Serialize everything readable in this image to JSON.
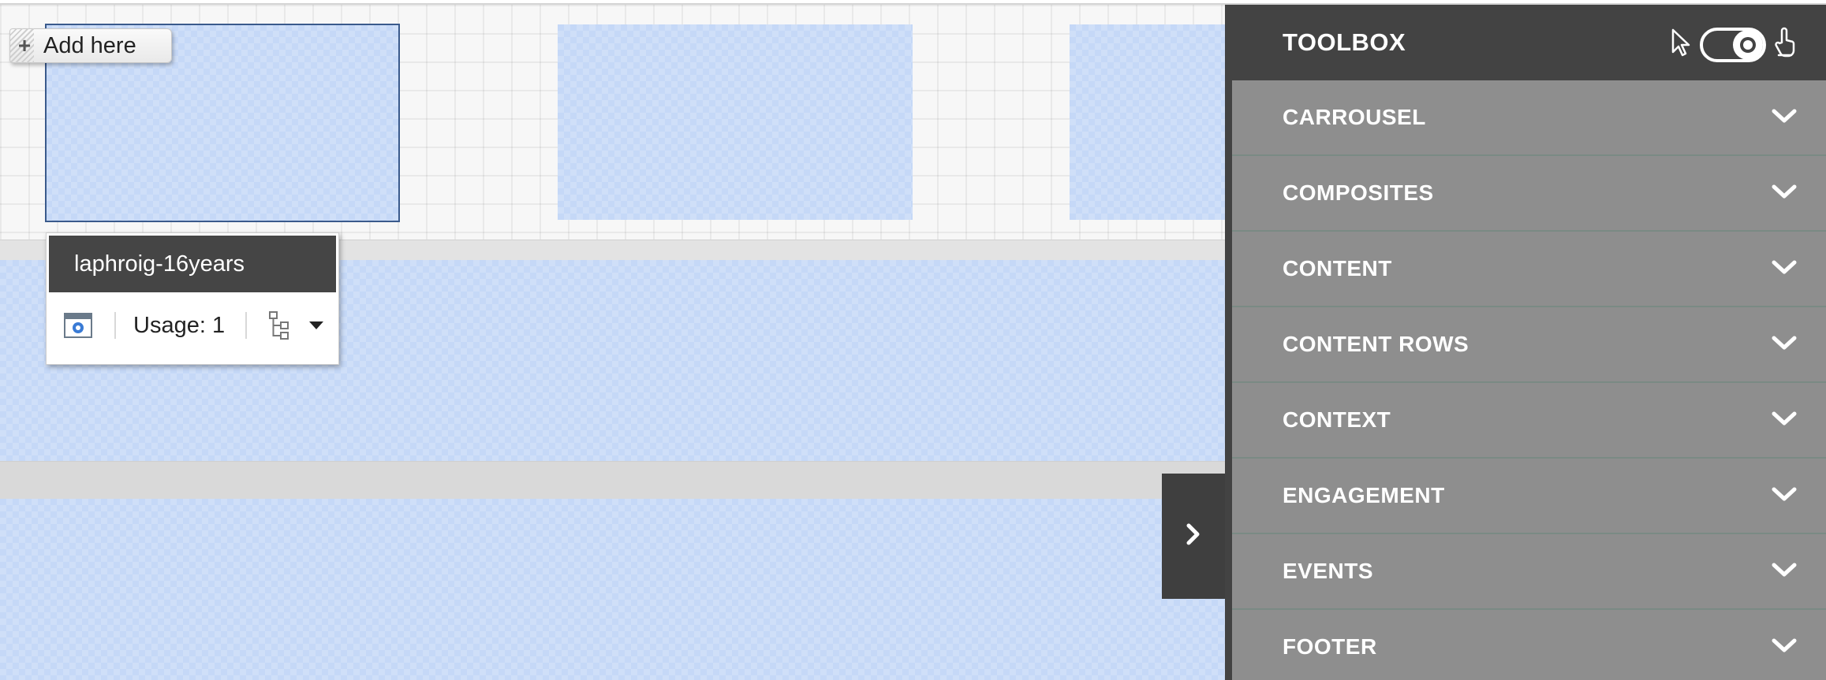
{
  "canvas": {
    "add_here_label": "Add here",
    "popup": {
      "name": "laphroig-16years",
      "usage_label": "Usage: 1"
    }
  },
  "toolbox": {
    "title": "TOOLBOX",
    "mode": "touch",
    "items": [
      {
        "label": "CARROUSEL"
      },
      {
        "label": "COMPOSITES"
      },
      {
        "label": "CONTENT"
      },
      {
        "label": "CONTENT ROWS"
      },
      {
        "label": "CONTEXT"
      },
      {
        "label": "ENGAGEMENT"
      },
      {
        "label": "EVENTS"
      },
      {
        "label": "FOOTER"
      }
    ]
  },
  "icons": {
    "toolbox_item": "chevron-down-icon",
    "collapse": "chevron-right-icon",
    "popup_settings": "settings-window-icon",
    "popup_tree": "hierarchy-icon",
    "popup_menu": "caret-down-icon",
    "mode_left": "mouse-pointer-icon",
    "mode_right": "touch-hand-icon"
  },
  "colors": {
    "toolbox_bg": "#434343",
    "toolbox_item_bg": "#8e8e8e",
    "slot_fill": "#c5d8f7",
    "selection_outline": "#3a5a8c"
  }
}
